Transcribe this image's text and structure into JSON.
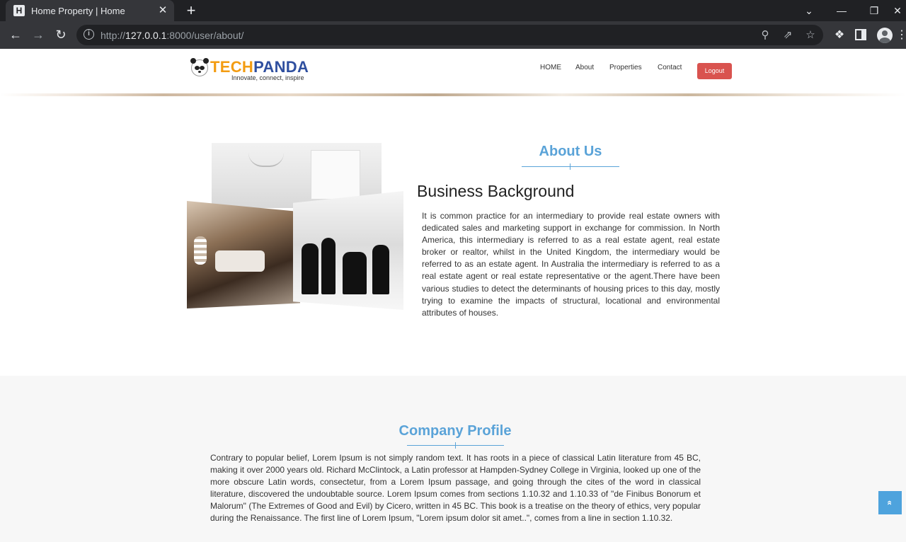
{
  "browser": {
    "tab_title": "Home Property | Home",
    "tab_favicon": "H",
    "url_scheme": "http://",
    "url_host": "127.0.0.1",
    "url_path": ":8000/user/about/",
    "icons": {
      "back": "←",
      "forward": "→",
      "reload": "↻",
      "close": "✕",
      "new_tab": "+",
      "tab_search": "⌄",
      "minimize": "—",
      "maximize": "❐",
      "window_close": "✕",
      "zoom": "⚲",
      "share": "⇗",
      "star": "☆",
      "extensions": "❖",
      "menu": "⋮",
      "info": "i"
    }
  },
  "site": {
    "logo": {
      "brand_part1": "TECH",
      "brand_part2": "PANDA",
      "tagline": "Innovate, connect, inspire"
    },
    "nav": {
      "home": "HOME",
      "about": "About",
      "properties": "Properties",
      "contact": "Contact",
      "logout": "Logout"
    }
  },
  "about": {
    "title": "About Us",
    "heading": "Business Background",
    "body": "It is common practice for an intermediary to provide real estate owners with dedicated sales and marketing support in exchange for commission. In North America, this intermediary is referred to as a real estate agent, real estate broker or realtor, whilst in the United Kingdom, the intermediary would be referred to as an estate agent. In Australia the intermediary is referred to as a real estate agent or real estate representative or the agent.There have been various studies to detect the determinants of housing prices to this day, mostly trying to examine the impacts of structural, locational and environmental attributes of houses."
  },
  "profile": {
    "title": "Company Profile",
    "body": "Contrary to popular belief, Lorem Ipsum is not simply random text. It has roots in a piece of classical Latin literature from 45 BC, making it over 2000 years old. Richard McClintock, a Latin professor at Hampden-Sydney College in Virginia, looked up one of the more obscure Latin words, consectetur, from a Lorem Ipsum passage, and going through the cites of the word in classical literature, discovered the undoubtable source. Lorem Ipsum comes from sections 1.10.32 and 1.10.33 of \"de Finibus Bonorum et Malorum\" (The Extremes of Good and Evil) by Cicero, written in 45 BC. This book is a treatise on the theory of ethics, very popular during the Renaissance. The first line of Lorem Ipsum, \"Lorem ipsum dolor sit amet..\", comes from a line in section 1.10.32."
  },
  "scroll_top_icon": "»",
  "colors": {
    "accent": "#5aa3d8",
    "logout": "#d9534f",
    "brand_orange": "#f39c12",
    "brand_blue": "#2f4f9f",
    "section_bg": "#f7f7f7"
  }
}
